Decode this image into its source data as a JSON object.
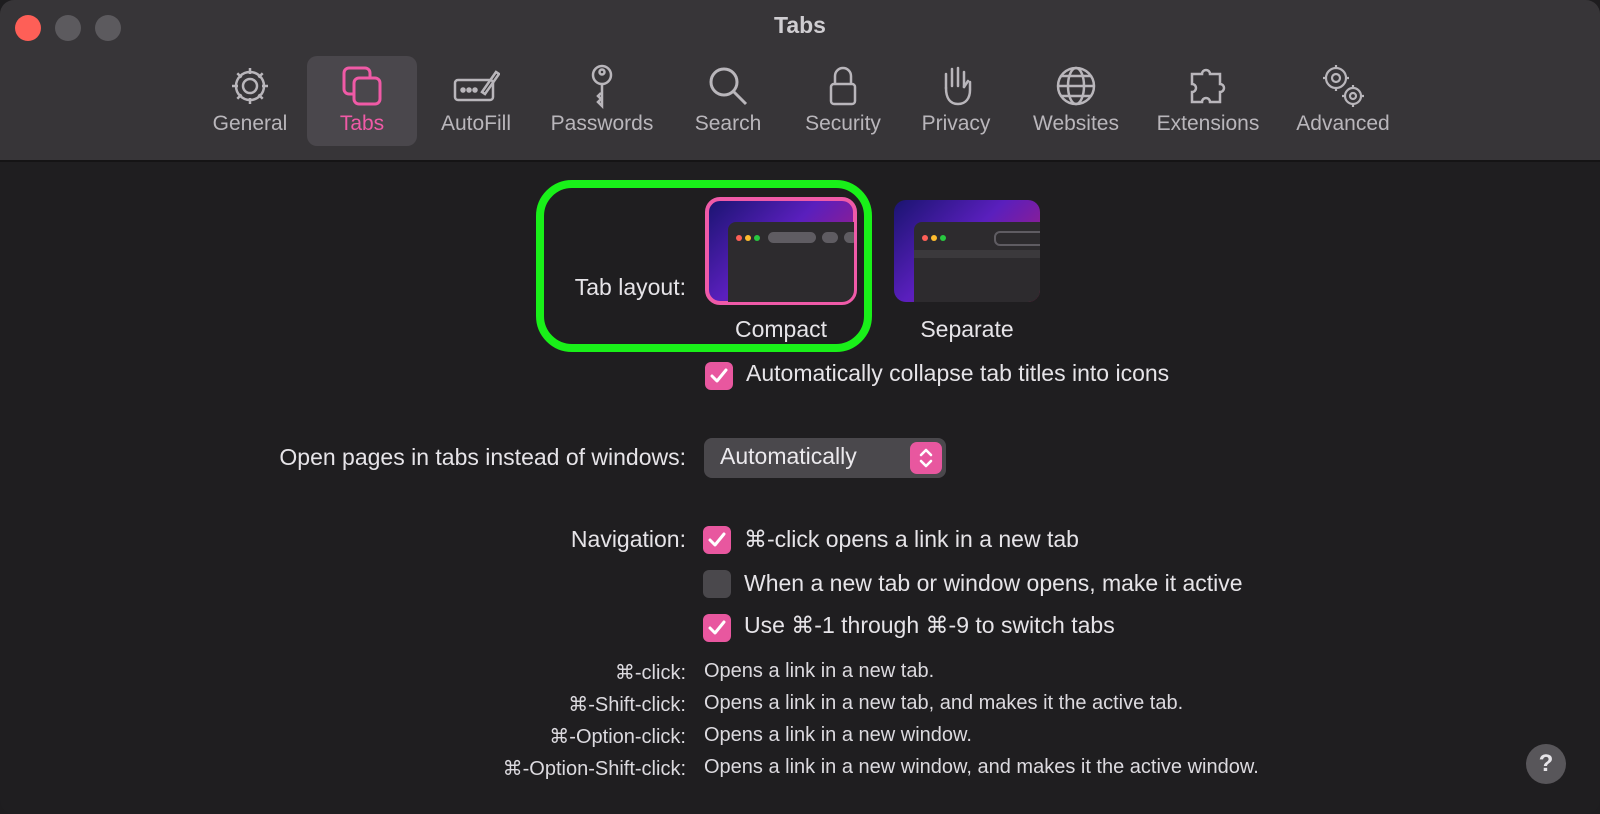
{
  "window": {
    "title": "Tabs"
  },
  "toolbar": {
    "items": [
      {
        "label": "General",
        "icon": "gear-icon"
      },
      {
        "label": "Tabs",
        "icon": "tabs-icon",
        "active": true
      },
      {
        "label": "AutoFill",
        "icon": "autofill-icon"
      },
      {
        "label": "Passwords",
        "icon": "key-icon"
      },
      {
        "label": "Search",
        "icon": "magnifier-icon"
      },
      {
        "label": "Security",
        "icon": "lock-icon"
      },
      {
        "label": "Privacy",
        "icon": "hand-icon"
      },
      {
        "label": "Websites",
        "icon": "globe-icon"
      },
      {
        "label": "Extensions",
        "icon": "puzzle-icon"
      },
      {
        "label": "Advanced",
        "icon": "gears-icon"
      }
    ]
  },
  "tab_layout": {
    "label": "Tab layout:",
    "options": [
      {
        "label": "Compact",
        "selected": true
      },
      {
        "label": "Separate",
        "selected": false
      }
    ],
    "collapse_label": "Automatically collapse tab titles into icons",
    "collapse_checked": true
  },
  "open_pages": {
    "label": "Open pages in tabs instead of windows:",
    "value": "Automatically"
  },
  "navigation": {
    "label": "Navigation:",
    "options": [
      {
        "label": "⌘-click opens a link in a new tab",
        "checked": true
      },
      {
        "label": "When a new tab or window opens, make it active",
        "checked": false
      },
      {
        "label": "Use ⌘-1 through ⌘-9 to switch tabs",
        "checked": true
      }
    ]
  },
  "shortcuts": [
    {
      "key": "⌘-click:",
      "desc": "Opens a link in a new tab."
    },
    {
      "key": "⌘-Shift-click:",
      "desc": "Opens a link in a new tab, and makes it the active tab."
    },
    {
      "key": "⌘-Option-click:",
      "desc": "Opens a link in a new window."
    },
    {
      "key": "⌘-Option-Shift-click:",
      "desc": "Opens a link in a new window, and makes it the active window."
    }
  ],
  "help": {
    "label": "?"
  },
  "colors": {
    "accent": "#e8579f",
    "highlight": "#19f019",
    "close": "#fe5f57"
  }
}
